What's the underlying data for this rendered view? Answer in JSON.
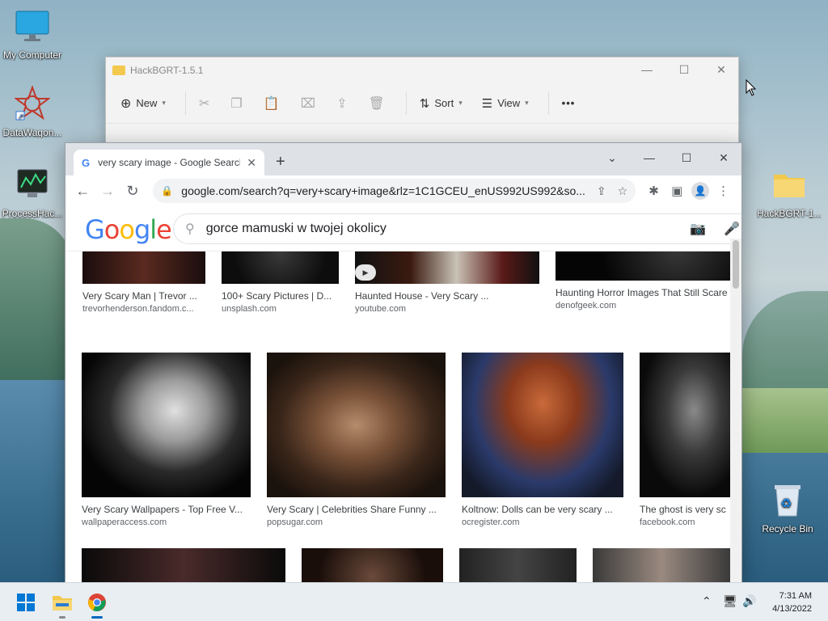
{
  "desktop": {
    "icons": [
      {
        "label": "My Computer"
      },
      {
        "label": "DataWagon..."
      },
      {
        "label": "ProcessHac..."
      },
      {
        "label": "HackBGRT-1..."
      },
      {
        "label": "Recycle Bin"
      }
    ]
  },
  "explorer": {
    "title": "HackBGRT-1.5.1",
    "toolbar": {
      "new": "New",
      "sort": "Sort",
      "view": "View",
      "more": "•••"
    }
  },
  "chrome": {
    "tab_title": "very scary image - Google Search",
    "url": "google.com/search?q=very+scary+image&rlz=1C1GCEU_enUS992US992&so...",
    "search_query": "gorce mamuski w twojej okolicy",
    "logo": "Google",
    "results_row1": [
      {
        "title": "Very Scary Man | Trevor ...",
        "site": "trevorhenderson.fandom.c..."
      },
      {
        "title": "100+ Scary Pictures | D...",
        "site": "unsplash.com"
      },
      {
        "title": "Haunted House - Very Scary ...",
        "site": "youtube.com"
      },
      {
        "title": "Haunting Horror Images That Still Scare",
        "site": "denofgeek.com"
      }
    ],
    "results_row2": [
      {
        "title": "Very Scary Wallpapers - Top Free V...",
        "site": "wallpaperaccess.com"
      },
      {
        "title": "Very Scary | Celebrities Share Funny ...",
        "site": "popsugar.com"
      },
      {
        "title": "Koltnow: Dolls can be very scary ...",
        "site": "ocregister.com"
      },
      {
        "title": "The ghost is very sc",
        "site": "facebook.com"
      }
    ]
  },
  "taskbar": {
    "time": "7:31 AM",
    "date": "4/13/2022"
  }
}
